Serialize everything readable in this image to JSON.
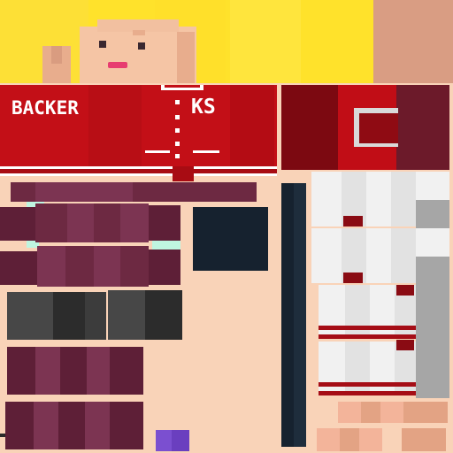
{
  "texture": {
    "chest_text": "BACKER",
    "chest_initials": "KS"
  },
  "colors": {
    "hair": "#ffe22b",
    "skin": "#f5c5a5",
    "jacket_red": "#c30f17",
    "jacket_dark": "#7c0911",
    "pants_maroon": "#6d2942",
    "navy": "#16222f",
    "shirt_white": "#f1f1f1",
    "mouth_pink": "#e73d70"
  }
}
